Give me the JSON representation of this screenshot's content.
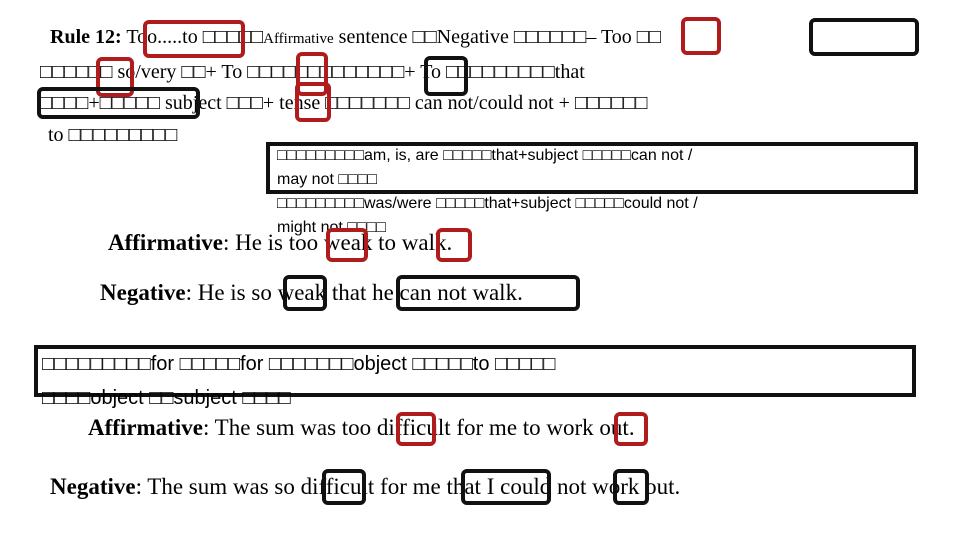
{
  "rule": {
    "title": "Rule 12:",
    "line1": [
      "Too.....to",
      "□□□□□",
      "Affirmative",
      " sentence □□Negative □□□□□□– Too □□"
    ],
    "line2": "□□□□□□ so/very □□+ To □□□□□□□□□□□□□+ To □□□□□□□□□that",
    "line3": "□□□□+□□□□□ subject □□□+ tense □□□□□□□       can not/could not + □□□□□□",
    "line4": "to □□□□□□□□□"
  },
  "note": {
    "line1": "□□□□□□□□□am, is, are □□□□□that+subject □□□□□can not /",
    "line2": "may not □□□□",
    "line3": "□□□□□□□□□was/were □□□□□that+subject □□□□□could not /",
    "line4": "might not □□□□"
  },
  "example1": {
    "aff_label": "Affirmative",
    "aff_text": ": He is too weak to walk.",
    "neg_label": "Negative",
    "neg_text": ": He is so weak that he can not walk."
  },
  "note2": {
    "line1": "□□□□□□□□□for □□□□□for □□□□□□□object □□□□□to □□□□□",
    "line2": "□□□□object □□subject □□□□"
  },
  "example2": {
    "aff_label": "Affirmative",
    "aff_text": ": The sum was too difficult for me to work out.",
    "neg_label": "Negative",
    "neg_text": ": The sum was so difficult for me  that I could not work out."
  },
  "colors": {
    "highlight_red": "#b01c1c",
    "highlight_black": "#111111"
  }
}
